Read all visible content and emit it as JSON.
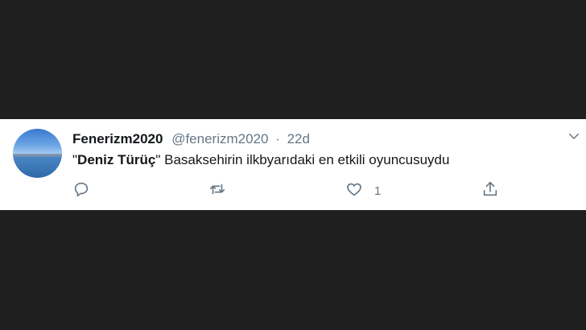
{
  "tweet": {
    "display_name": "Fenerizm2020",
    "handle": "@fenerizm2020",
    "separator": "·",
    "timestamp": "22d",
    "text_quote_open": "\"",
    "text_bold": "Deniz Türüç",
    "text_quote_close": "\"",
    "text_rest": " Basaksehirin ilkbyarıdaki en etkili oyuncusuydu",
    "like_count": "1"
  },
  "icons": {
    "menu": "chevron-down-icon",
    "reply": "reply-icon",
    "retweet": "retweet-icon",
    "like": "heart-icon",
    "share": "share-icon"
  },
  "colors": {
    "background": "#1f1f1f",
    "card": "#ffffff",
    "secondary_text": "#657786",
    "primary_text": "#14171a"
  }
}
